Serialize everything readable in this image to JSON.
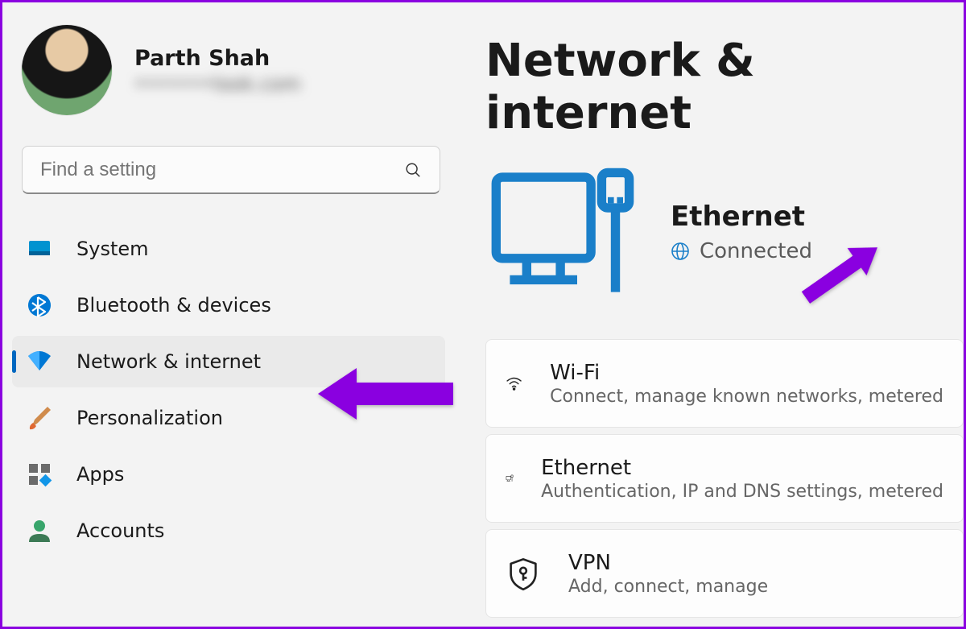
{
  "profile": {
    "name": "Parth Shah",
    "email": "•••••••look.com"
  },
  "search": {
    "placeholder": "Find a setting"
  },
  "nav": {
    "system": "System",
    "bluetooth": "Bluetooth & devices",
    "network": "Network & internet",
    "personalization": "Personalization",
    "apps": "Apps",
    "accounts": "Accounts"
  },
  "page": {
    "title": "Network & internet"
  },
  "status": {
    "name": "Ethernet",
    "state": "Connected"
  },
  "cards": {
    "wifi": {
      "title": "Wi-Fi",
      "sub": "Connect, manage known networks, metered"
    },
    "ethernet": {
      "title": "Ethernet",
      "sub": "Authentication, IP and DNS settings, metered"
    },
    "vpn": {
      "title": "VPN",
      "sub": "Add, connect, manage"
    }
  }
}
